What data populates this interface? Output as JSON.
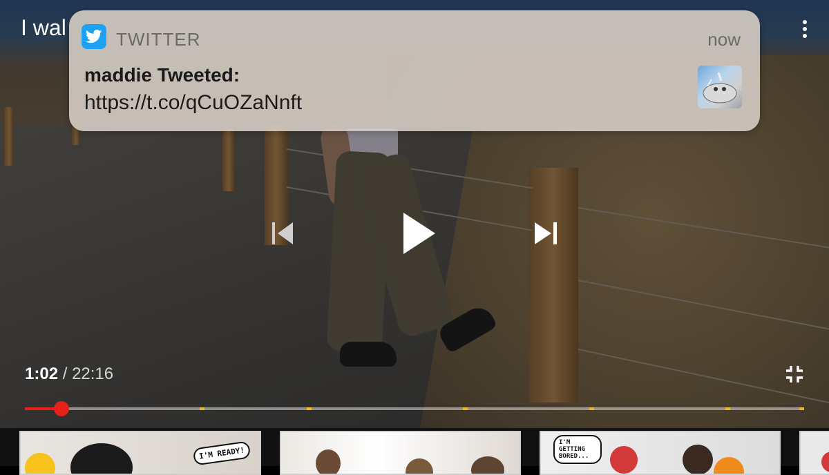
{
  "video": {
    "title_visible": "I wal"
  },
  "notification": {
    "app_name": "TWITTER",
    "time": "now",
    "title": "maddie Tweeted:",
    "body": "https://t.co/qCuOZaNnft",
    "icon": "twitter-bird-icon",
    "app_color": "#1da1f2"
  },
  "player": {
    "current_time": "1:02",
    "separator": "/",
    "duration": "22:16",
    "progress_fraction": 0.0466,
    "chapter_markers_fraction": [
      0.224,
      0.362,
      0.562,
      0.724,
      0.899,
      0.998
    ],
    "accent_color": "#e62117",
    "marker_color": "#f2b21a",
    "icons": {
      "previous": "skip-previous-icon",
      "play": "play-icon",
      "next": "skip-next-icon",
      "collapse": "exit-fullscreen-icon",
      "menu": "more-vert-icon"
    }
  },
  "suggestions": {
    "items": [
      {
        "bubble_text": "I'M READY!"
      },
      {
        "bubble_text": ""
      },
      {
        "bubble_text": "I'M GETTING BORED..."
      },
      {
        "bubble_text": ""
      }
    ]
  }
}
